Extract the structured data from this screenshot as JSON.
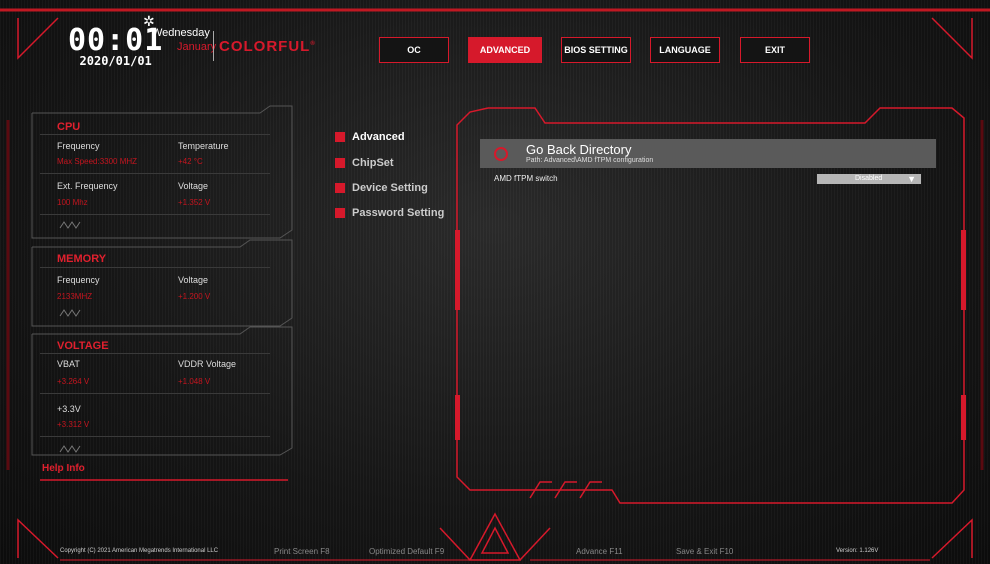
{
  "clock": {
    "time": "00:01",
    "date": "2020/01/01",
    "weekday": "Wednesday",
    "month": "January"
  },
  "brand": {
    "logo": "COLORFUL",
    "logo_mark": "®"
  },
  "nav": [
    {
      "label": "OC",
      "active": false
    },
    {
      "label": "ADVANCED",
      "active": true
    },
    {
      "label": "BIOS SETTING",
      "active": false
    },
    {
      "label": "LANGUAGE",
      "active": false
    },
    {
      "label": "EXIT",
      "active": false
    }
  ],
  "cpu": {
    "title": "CPU",
    "frequency_label": "Frequency",
    "frequency_value": "Max Speed:3300 MHZ",
    "temperature_label": "Temperature",
    "temperature_value": "+42 °C",
    "ext_freq_label": "Ext. Frequency",
    "ext_freq_value": "100 Mhz",
    "voltage_label": "Voltage",
    "voltage_value": "+1.352 V"
  },
  "memory": {
    "title": "MEMORY",
    "frequency_label": "Frequency",
    "frequency_value": "2133MHZ",
    "voltage_label": "Voltage",
    "voltage_value": "+1.200 V"
  },
  "voltage": {
    "title": "VOLTAGE",
    "vbat_label": "VBAT",
    "vbat_value": "+3.264 V",
    "vddr_label": "VDDR Voltage",
    "vddr_value": "+1.048 V",
    "v33_label": "+3.3V",
    "v33_value": "+3.312 V"
  },
  "help_info": "Help Info",
  "menu": [
    {
      "label": "Advanced",
      "active": true
    },
    {
      "label": "ChipSet",
      "active": false
    },
    {
      "label": "Device Setting",
      "active": false
    },
    {
      "label": "Password Setting",
      "active": false
    }
  ],
  "content": {
    "go_back_title": "Go Back Directory",
    "go_back_path": "Path: Advanced\\AMD fTPM configuration",
    "setting_label": "AMD fTPM switch",
    "setting_value": "Disabled"
  },
  "footer": {
    "copyright": "Copyright (C) 2021 American Megatrends International LLC",
    "print_screen": "Print Screen F8",
    "optimized_default": "Optimized Default F9",
    "advance": "Advance F11",
    "save_exit": "Save & Exit F10",
    "version": "Version: 1.126V"
  },
  "colors": {
    "accent": "#d6192b",
    "background": "#151515",
    "highlight_row": "#5a5a5a",
    "select": "#b6b6b6"
  }
}
